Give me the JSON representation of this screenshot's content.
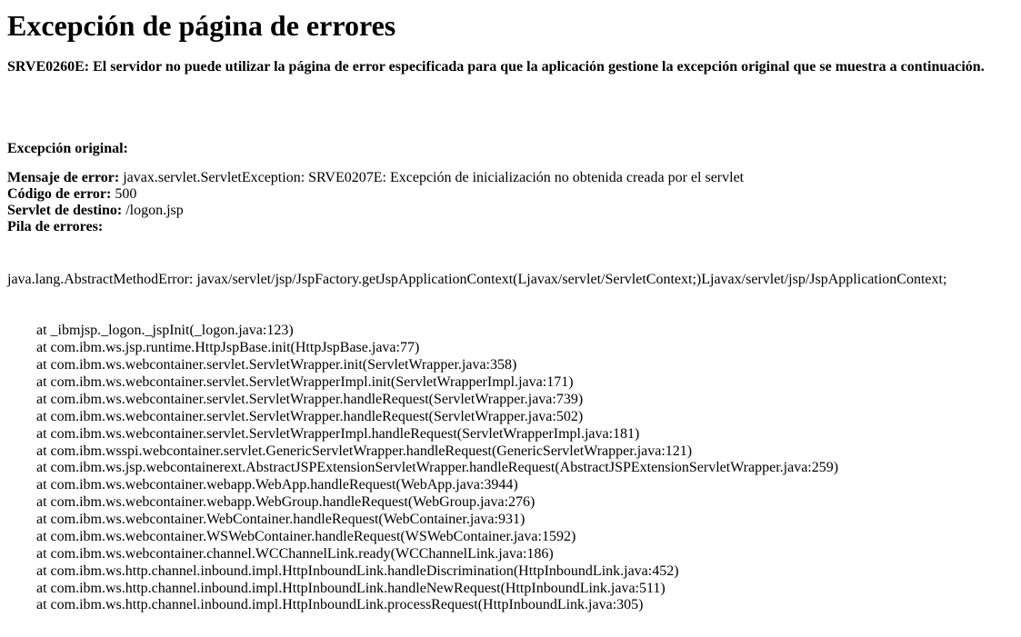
{
  "title": "Excepción de página de errores",
  "subhead": "SRVE0260E: El servidor no puede utilizar la página de error especificada para que la aplicación gestione la excepción original que se muestra a continuación.",
  "original_section_label": "Excepción original:",
  "error_message_label": "Mensaje de error:",
  "error_message_value": "javax.servlet.ServletException: SRVE0207E: Excepción de inicialización no obtenida creada por el servlet",
  "error_code_label": "Código de error:",
  "error_code_value": "500",
  "target_servlet_label": "Servlet de destino:",
  "target_servlet_value": "/logon.jsp",
  "error_stack_label": "Pila de errores:",
  "stack_head": "java.lang.AbstractMethodError: javax/servlet/jsp/JspFactory.getJspApplicationContext(Ljavax/servlet/ServletContext;)Ljavax/servlet/jsp/JspApplicationContext;",
  "stack_frames": [
    "at _ibmjsp._logon._jspInit(_logon.java:123)",
    "at com.ibm.ws.jsp.runtime.HttpJspBase.init(HttpJspBase.java:77)",
    "at com.ibm.ws.webcontainer.servlet.ServletWrapper.init(ServletWrapper.java:358)",
    "at com.ibm.ws.webcontainer.servlet.ServletWrapperImpl.init(ServletWrapperImpl.java:171)",
    "at com.ibm.ws.webcontainer.servlet.ServletWrapper.handleRequest(ServletWrapper.java:739)",
    "at com.ibm.ws.webcontainer.servlet.ServletWrapper.handleRequest(ServletWrapper.java:502)",
    "at com.ibm.ws.webcontainer.servlet.ServletWrapperImpl.handleRequest(ServletWrapperImpl.java:181)",
    "at com.ibm.wsspi.webcontainer.servlet.GenericServletWrapper.handleRequest(GenericServletWrapper.java:121)",
    "at com.ibm.ws.jsp.webcontainerext.AbstractJSPExtensionServletWrapper.handleRequest(AbstractJSPExtensionServletWrapper.java:259)",
    "at com.ibm.ws.webcontainer.webapp.WebApp.handleRequest(WebApp.java:3944)",
    "at com.ibm.ws.webcontainer.webapp.WebGroup.handleRequest(WebGroup.java:276)",
    "at com.ibm.ws.webcontainer.WebContainer.handleRequest(WebContainer.java:931)",
    "at com.ibm.ws.webcontainer.WSWebContainer.handleRequest(WSWebContainer.java:1592)",
    "at com.ibm.ws.webcontainer.channel.WCChannelLink.ready(WCChannelLink.java:186)",
    "at com.ibm.ws.http.channel.inbound.impl.HttpInboundLink.handleDiscrimination(HttpInboundLink.java:452)",
    "at com.ibm.ws.http.channel.inbound.impl.HttpInboundLink.handleNewRequest(HttpInboundLink.java:511)",
    "at com.ibm.ws.http.channel.inbound.impl.HttpInboundLink.processRequest(HttpInboundLink.java:305)"
  ]
}
